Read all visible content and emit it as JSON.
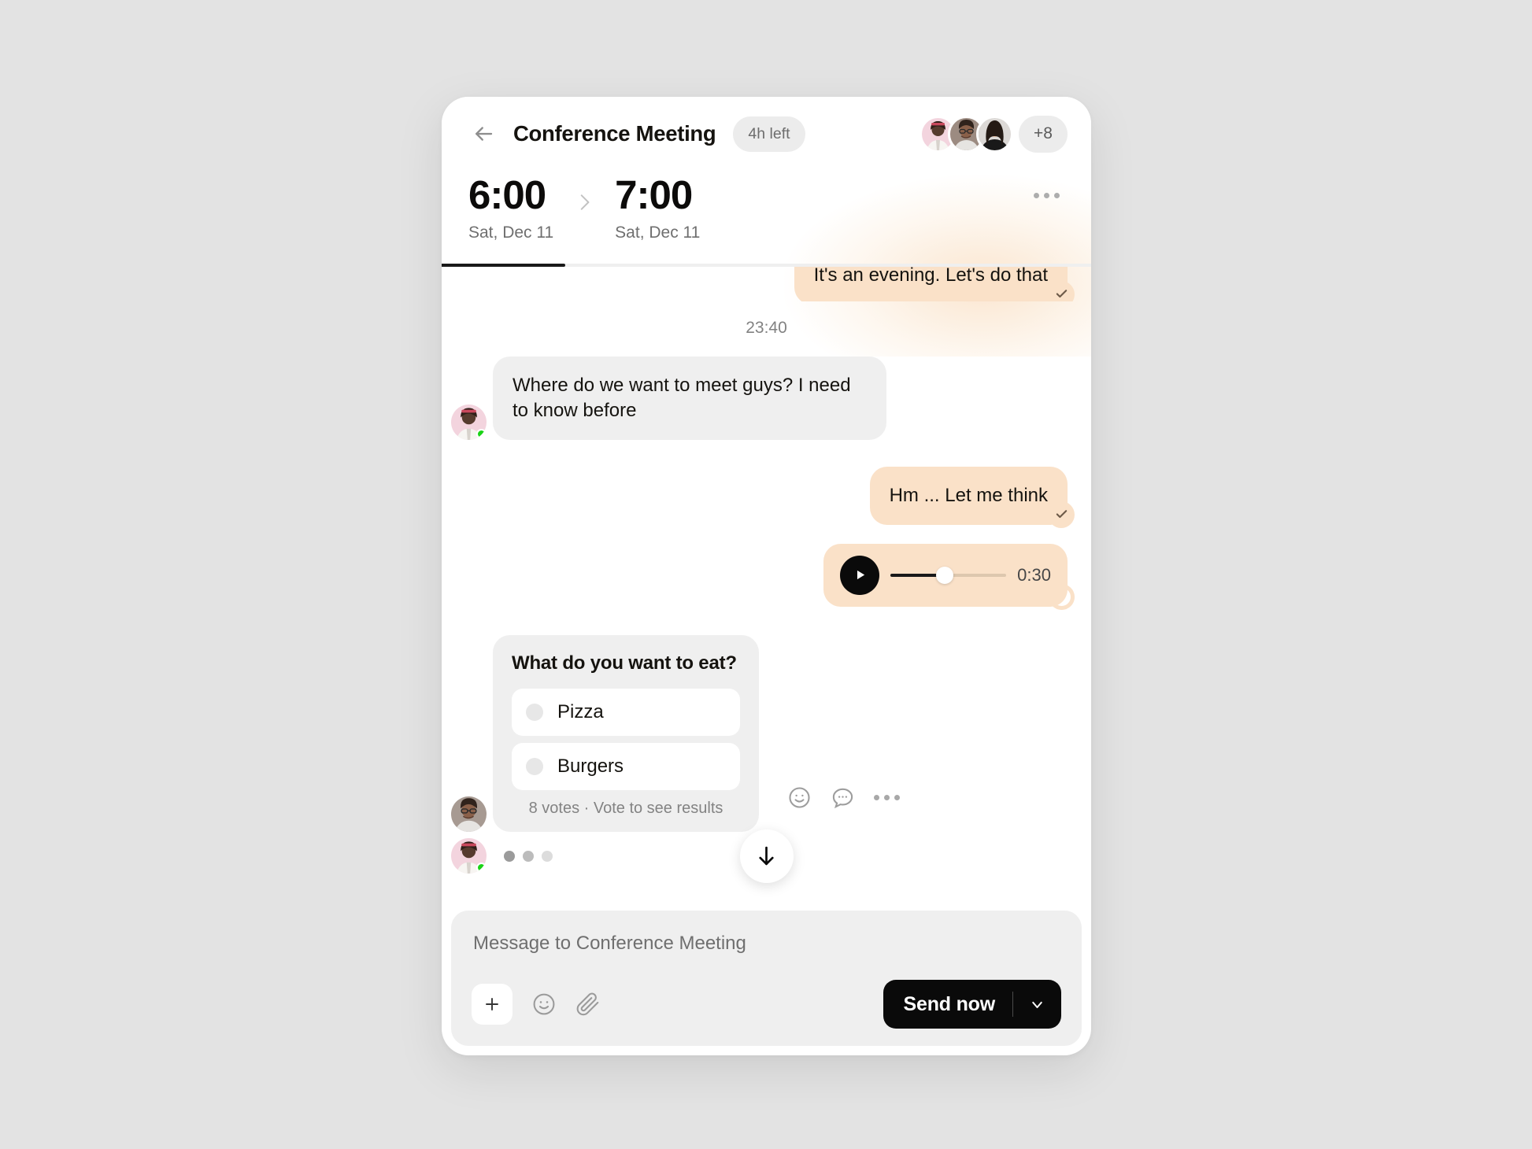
{
  "header": {
    "back_icon": "arrow-left-icon",
    "title": "Conference Meeting",
    "time_left": "4h left",
    "overflow_count": "+8",
    "more_icon": "more-horizontal-icon",
    "start": {
      "time": "6:00",
      "date": "Sat, Dec 11"
    },
    "end": {
      "time": "7:00",
      "date": "Sat, Dec 11"
    },
    "arrow_icon": "chevron-right-icon",
    "participants": [
      {
        "name": "participant-1",
        "bg": "#f3d4de"
      },
      {
        "name": "participant-2",
        "bg": "#8f7e74"
      },
      {
        "name": "participant-3",
        "bg": "#d6d3d1"
      }
    ],
    "scroll_progress_percent": 19
  },
  "messages": {
    "clipped": {
      "text": "It's an evening. Let's do that",
      "status_icon": "check-icon"
    },
    "timestamp": "23:40",
    "incoming_1": {
      "text": "Where do we want to meet guys? I need to know before",
      "avatar": "avatar-online",
      "online": true
    },
    "outgoing_1": {
      "text": "Hm ... Let me think",
      "status_icon": "check-icon"
    },
    "voice": {
      "play_icon": "play-icon",
      "duration": "0:30",
      "progress_percent": 47,
      "status_icon": "pending-circle-icon"
    },
    "poll": {
      "question": "What do you want to eat?",
      "options": [
        {
          "label": "Pizza"
        },
        {
          "label": "Burgers"
        }
      ],
      "meta": "8 votes · Vote to see results",
      "actions": [
        {
          "name": "react-icon"
        },
        {
          "name": "reply-icon"
        },
        {
          "name": "more-horizontal-icon"
        }
      ]
    },
    "typing": {
      "avatar": "avatar-online",
      "dots": 3
    },
    "scroll_down_icon": "arrow-down-icon"
  },
  "composer": {
    "placeholder": "Message to Conference Meeting",
    "add_icon": "plus-icon",
    "emoji_icon": "smiley-icon",
    "attach_icon": "paperclip-icon",
    "send_label": "Send now",
    "send_chevron_icon": "chevron-down-icon"
  },
  "colors": {
    "accent_bubble": "#fae1c8",
    "incoming_bubble": "#efefef",
    "send_button": "#0a0a0a",
    "online_dot": "#1ad316",
    "page_bg": "#e3e3e3"
  }
}
